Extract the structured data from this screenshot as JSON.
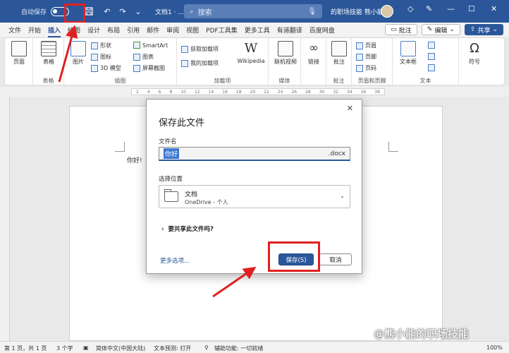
{
  "titlebar": {
    "autosave_label": "自动保存",
    "autosave_state": "关",
    "doc_title": "文档1 · ...",
    "search_placeholder": "搜索",
    "user_name": "的职场技能 熊小能",
    "window_controls": [
      "—",
      "☐",
      "✕"
    ]
  },
  "tabs": [
    "文件",
    "开始",
    "插入",
    "绘图",
    "设计",
    "布局",
    "引用",
    "邮件",
    "审阅",
    "视图",
    "PDF工具集",
    "更多工具",
    "有道翻译",
    "百度网盘"
  ],
  "active_tab": "插入",
  "menu_right": {
    "comment": "批注",
    "edit": "编辑",
    "share": "共享"
  },
  "ribbon": {
    "groups": [
      {
        "label": "页面",
        "buttons": [
          "页面"
        ]
      },
      {
        "label": "表格",
        "buttons": [
          "表格"
        ]
      },
      {
        "label": "插图",
        "buttons": [
          "图片",
          "形状",
          "图标",
          "3D 模型",
          "SmartArt",
          "图表",
          "屏幕截图"
        ]
      },
      {
        "label": "加载项",
        "buttons": [
          "获取加载项",
          "我的加载项",
          "Wikipedia"
        ]
      },
      {
        "label": "媒体",
        "buttons": [
          "联机视频"
        ]
      },
      {
        "label": "",
        "buttons": [
          "链接"
        ]
      },
      {
        "label": "批注",
        "buttons": [
          "批注"
        ]
      },
      {
        "label": "页眉和页脚",
        "buttons": [
          "页眉",
          "页脚",
          "页码"
        ]
      },
      {
        "label": "文本",
        "buttons": [
          "文本框"
        ]
      },
      {
        "label": "",
        "buttons": [
          "符号"
        ]
      }
    ]
  },
  "ruler_ticks": [
    "2",
    "4",
    "6",
    "8",
    "10",
    "12",
    "14",
    "16",
    "18",
    "20",
    "22",
    "24",
    "26",
    "28",
    "30",
    "32",
    "34",
    "36",
    "38"
  ],
  "document": {
    "text": "你好!"
  },
  "dialog": {
    "title": "保存此文件",
    "close_label": "✕",
    "filename_label": "文件名",
    "filename_value": "你好",
    "filename_ext": ".docx",
    "location_label": "选择位置",
    "location_name": "文档",
    "location_sub": "OneDrive - 个人",
    "share_prompt": "要共享此文件吗?",
    "more_options": "更多选项...",
    "save_button": "保存(S)",
    "cancel_button": "取消"
  },
  "statusbar": {
    "page": "第 1 页，共 1 页",
    "words": "3 个字",
    "language": "简体中文(中国大陆)",
    "prediction": "文本预测: 打开",
    "accessibility": "辅助功能: 一切就绪",
    "zoom": "100%"
  },
  "watermark": "@熊小能的职场技能",
  "colors": {
    "brand": "#2b579a",
    "highlight": "#e02020"
  }
}
